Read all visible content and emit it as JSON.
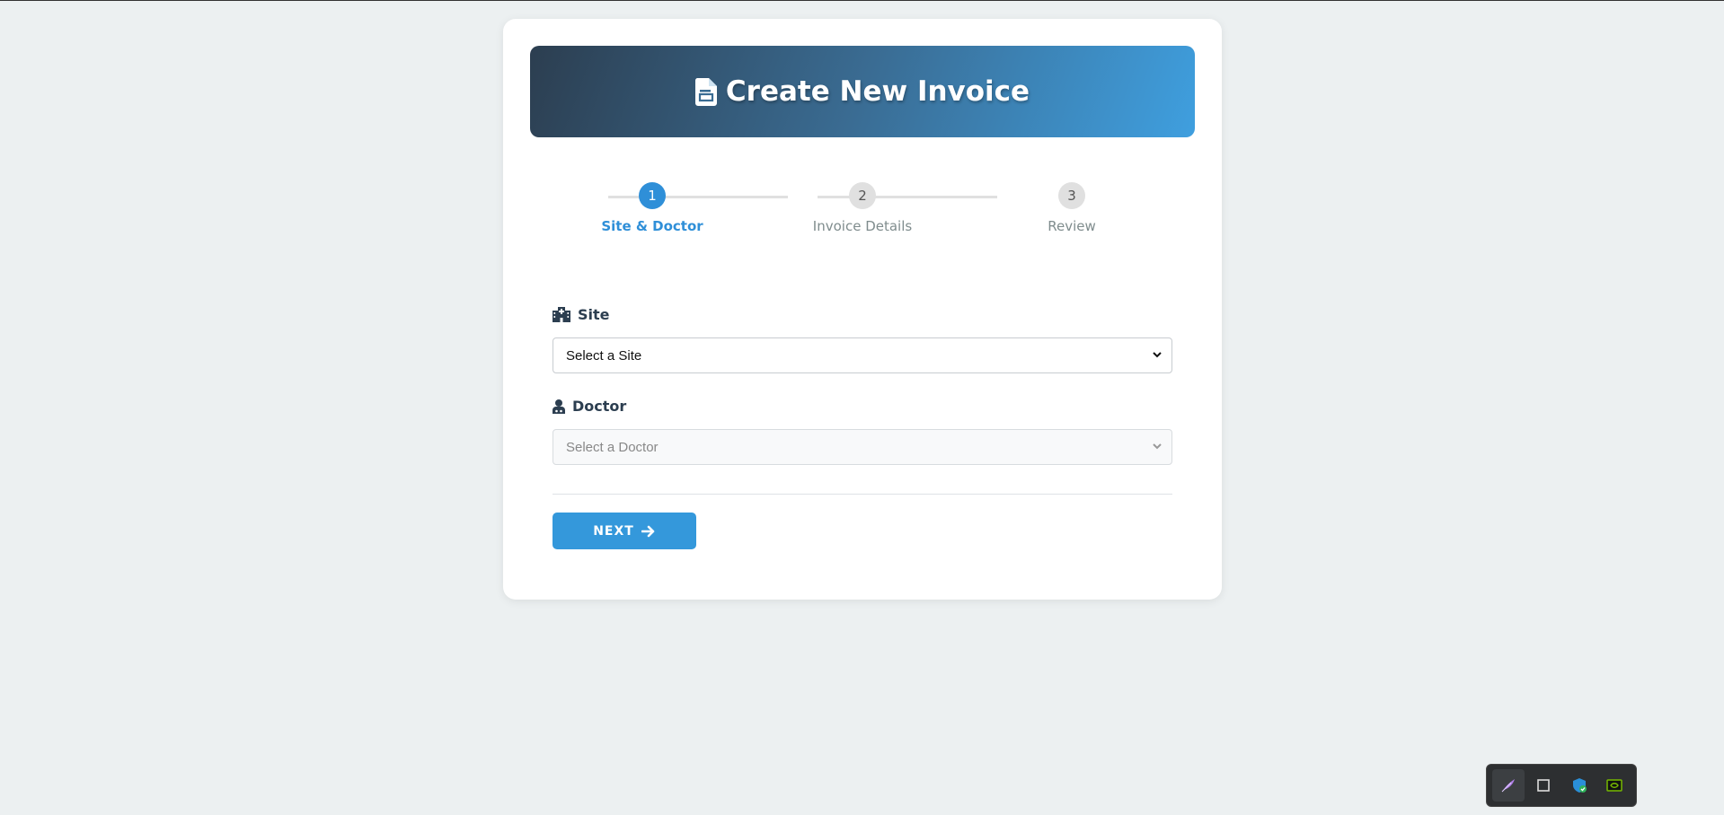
{
  "header": {
    "title": "Create New Invoice",
    "icon": "document-icon"
  },
  "stepper": {
    "steps": [
      {
        "number": "1",
        "label": "Site & Doctor",
        "active": true
      },
      {
        "number": "2",
        "label": "Invoice Details",
        "active": false
      },
      {
        "number": "3",
        "label": "Review",
        "active": false
      }
    ]
  },
  "form": {
    "site": {
      "label": "Site",
      "icon": "hospital-icon",
      "value": "Select a Site"
    },
    "doctor": {
      "label": "Doctor",
      "icon": "user-doctor-icon",
      "value": "Select a Doctor",
      "disabled": true
    }
  },
  "actions": {
    "next_label": "NEXT",
    "next_icon": "arrow-right-icon"
  },
  "tray": {
    "items": [
      "feather-icon",
      "window-icon",
      "shield-icon",
      "nvidia-icon"
    ]
  },
  "colors": {
    "accent": "#3498db",
    "header_gradient_start": "#2c3e50",
    "header_gradient_end": "#3f9fdf",
    "background": "#ecf0f1"
  }
}
